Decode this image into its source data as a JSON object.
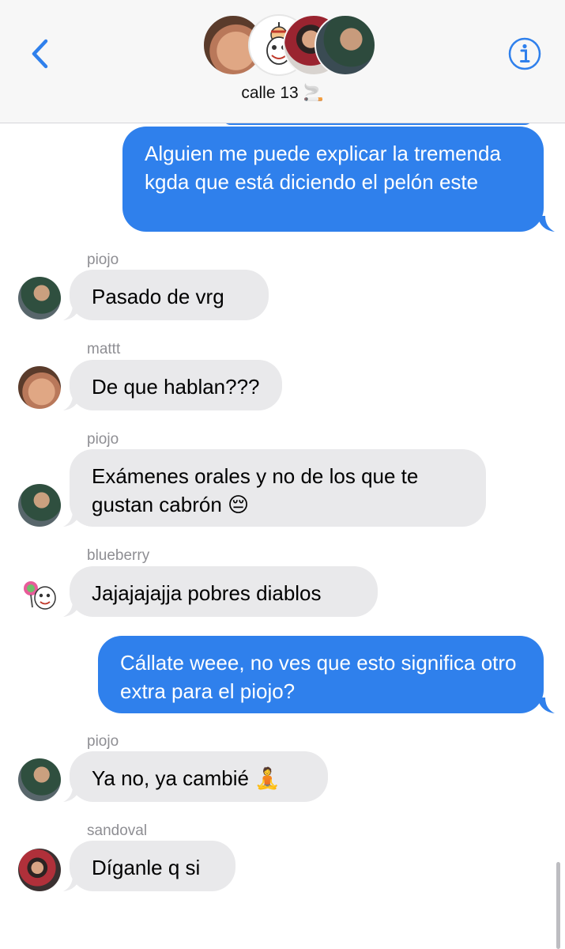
{
  "header": {
    "group_name": "calle 13 🚬"
  },
  "messages": [
    {
      "direction": "out",
      "text": "Alguien me puede explicar la tremenda kgda que está diciendo el pelón este"
    },
    {
      "direction": "in",
      "sender": "piojo",
      "text": "Pasado de vrg"
    },
    {
      "direction": "in",
      "sender": "mattt",
      "text": "De que hablan???"
    },
    {
      "direction": "in",
      "sender": "piojo",
      "text": "Exámenes orales y no de los que te gustan cabrón 😔"
    },
    {
      "direction": "in",
      "sender": "blueberry",
      "text": "Jajajajajja pobres diablos"
    },
    {
      "direction": "out",
      "text": "Cállate weee, no ves que esto significa otro extra para el piojo?"
    },
    {
      "direction": "in",
      "sender": "piojo",
      "text": "Ya no, ya cambié 🧘"
    },
    {
      "direction": "in",
      "sender": "sandoval",
      "text": "Díganle q si"
    }
  ],
  "colors": {
    "accent": "#2f80ec",
    "incoming_bubble": "#e9e9eb",
    "sender_label": "#8e8e93"
  },
  "icons": {
    "back": "chevron-left-icon",
    "info": "info-icon"
  }
}
